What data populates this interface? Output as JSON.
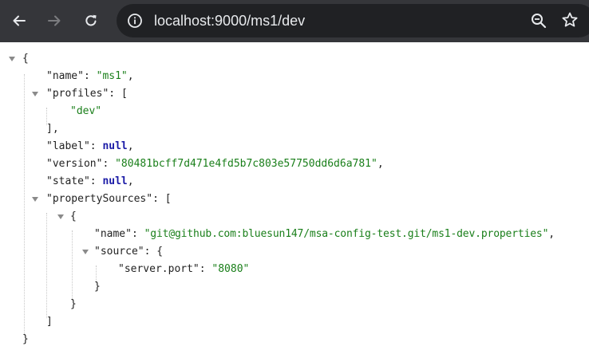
{
  "browser": {
    "url": "localhost:9000/ms1/dev"
  },
  "json": {
    "open_brace": "{",
    "close_brace": "}",
    "lines": {
      "name_key": "\"name\"",
      "name_value": "\"ms1\"",
      "profiles_key": "\"profiles\"",
      "profiles_open": "[",
      "profile_0": "\"dev\"",
      "profiles_close": "],",
      "label_key": "\"label\"",
      "label_value": "null",
      "version_key": "\"version\"",
      "version_value": "\"80481bcff7d471e4fd5b7c803e57750dd6d6a781\"",
      "state_key": "\"state\"",
      "state_value": "null",
      "ps_key": "\"propertySources\"",
      "ps_open": "[",
      "ps_item_open": "{",
      "ps_name_key": "\"name\"",
      "ps_name_value": "\"git@github.com:bluesun147/msa-config-test.git/ms1-dev.properties\"",
      "source_key": "\"source\"",
      "source_open": "{",
      "port_key": "\"server.port\"",
      "port_value": "\"8080\"",
      "source_close": "}",
      "ps_item_close": "}",
      "ps_close": "]"
    }
  }
}
